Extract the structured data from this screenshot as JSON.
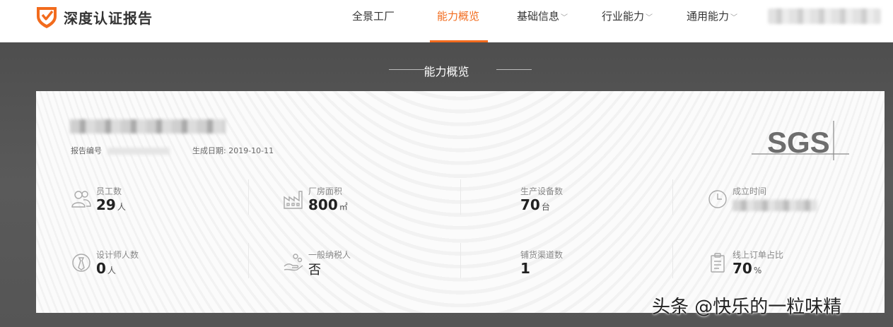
{
  "brand": {
    "name": "深度认证报告",
    "accent": "#f26b1d"
  },
  "nav": {
    "items": [
      {
        "label": "全景工厂",
        "has_dropdown": false
      },
      {
        "label": "能力概览",
        "has_dropdown": false,
        "active": true
      },
      {
        "label": "基础信息",
        "has_dropdown": true
      },
      {
        "label": "行业能力",
        "has_dropdown": true
      },
      {
        "label": "通用能力",
        "has_dropdown": true
      }
    ]
  },
  "section": {
    "title": "能力概览"
  },
  "report": {
    "number_label": "报告编号",
    "date_label": "生成日期:",
    "date_value": "2019-10-11",
    "cert_logo": "SGS"
  },
  "stats": [
    {
      "label": "员工数",
      "value": "29",
      "unit": "人",
      "icon": "people-icon"
    },
    {
      "label": "厂房面积",
      "value": "800",
      "unit": "㎡",
      "icon": "factory-icon"
    },
    {
      "label": "生产设备数",
      "value": "70",
      "unit": "台",
      "icon": "equipment-icon"
    },
    {
      "label": "成立时间",
      "value": "",
      "unit": "",
      "icon": "clock-icon"
    },
    {
      "label": "设计师人数",
      "value": "0",
      "unit": "人",
      "icon": "designer-icon"
    },
    {
      "label": "一般纳税人",
      "value": "否",
      "unit": "",
      "icon": "hand-coins-icon"
    },
    {
      "label": "铺货渠道数",
      "value": "1",
      "unit": "",
      "icon": "channel-icon"
    },
    {
      "label": "线上订单占比",
      "value": "70",
      "unit": "%",
      "icon": "clipboard-icon"
    }
  ],
  "watermark": "头条 @快乐的一粒味精"
}
